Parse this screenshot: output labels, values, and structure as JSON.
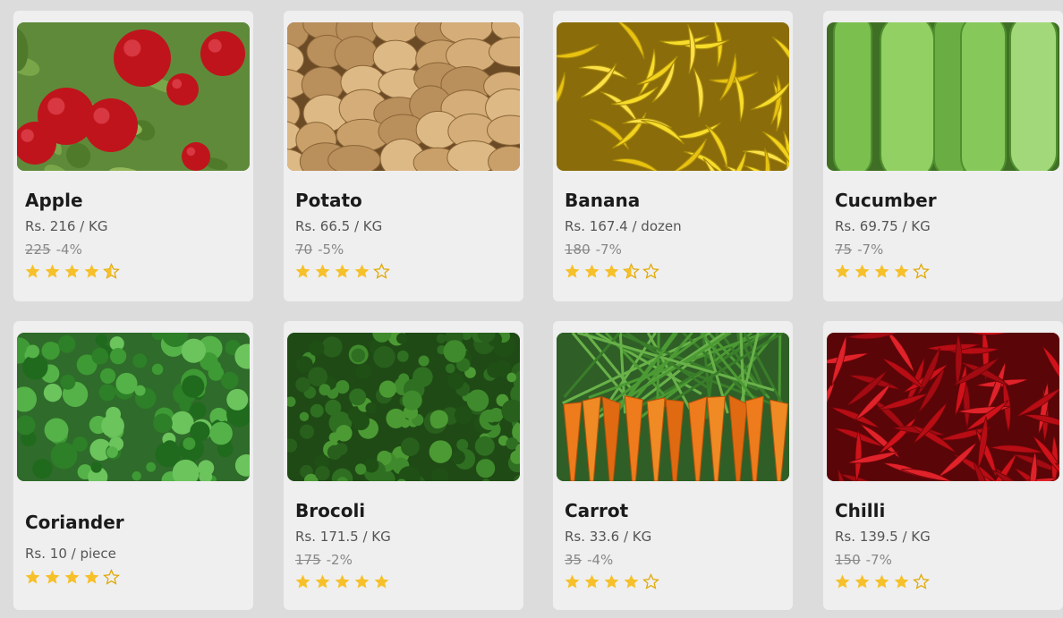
{
  "products": [
    {
      "name": "Apple",
      "price": "Rs. 216 / KG",
      "original": "225",
      "discount": "-4%",
      "rating": 4.5,
      "image": "apple-image"
    },
    {
      "name": "Potato",
      "price": "Rs. 66.5 / KG",
      "original": "70",
      "discount": "-5%",
      "rating": 4,
      "image": "potato-image"
    },
    {
      "name": "Banana",
      "price": "Rs. 167.4 / dozen",
      "original": "180",
      "discount": "-7%",
      "rating": 3.5,
      "image": "banana-image"
    },
    {
      "name": "Cucumber",
      "price": "Rs. 69.75 / KG",
      "original": "75",
      "discount": "-7%",
      "rating": 4,
      "image": "cucumber-image"
    },
    {
      "name": "Coriander",
      "price": "Rs. 10 / piece",
      "original": "",
      "discount": "",
      "rating": 4,
      "image": "coriander-image"
    },
    {
      "name": "Brocoli",
      "price": "Rs. 171.5 / KG",
      "original": "175",
      "discount": "-2%",
      "rating": 5,
      "image": "broccoli-image"
    },
    {
      "name": "Carrot",
      "price": "Rs. 33.6 / KG",
      "original": "35",
      "discount": "-4%",
      "rating": 4,
      "image": "carrot-image"
    },
    {
      "name": "Chilli",
      "price": "Rs. 139.5 / KG",
      "original": "150",
      "discount": "-7%",
      "rating": 4,
      "image": "chilli-image"
    }
  ],
  "colors": {
    "star": "#f6c02a",
    "star_outline": "#e0a800",
    "card_bg": "#efefef",
    "page_bg": "#dcdcdc"
  }
}
